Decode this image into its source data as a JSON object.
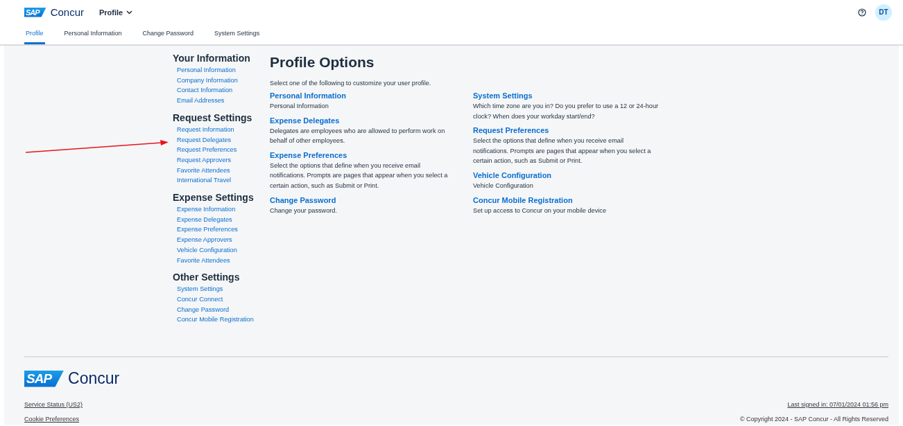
{
  "header": {
    "logo": {
      "mark": "SAP",
      "name": "Concur"
    },
    "menu": {
      "label": "Profile"
    },
    "avatar": {
      "initials": "DT"
    }
  },
  "tabs": [
    {
      "label": "Profile",
      "selected": true
    },
    {
      "label": "Personal Information",
      "selected": false
    },
    {
      "label": "Change Password",
      "selected": false
    },
    {
      "label": "System Settings",
      "selected": false
    }
  ],
  "sidebar": {
    "sections": [
      {
        "heading": "Your Information",
        "links": [
          "Personal Information",
          "Company Information",
          "Contact Information",
          "Email Addresses"
        ]
      },
      {
        "heading": "Request Settings",
        "links": [
          "Request Information",
          "Request Delegates",
          "Request Preferences",
          "Request Approvers",
          "Favorite Attendees",
          "International Travel"
        ]
      },
      {
        "heading": "Expense Settings",
        "links": [
          "Expense Information",
          "Expense Delegates",
          "Expense Preferences",
          "Expense Approvers",
          "Vehicle Configuration",
          "Favorite Attendees"
        ]
      },
      {
        "heading": "Other Settings",
        "links": [
          "System Settings",
          "Concur Connect",
          "Change Password",
          "Concur Mobile Registration"
        ]
      }
    ]
  },
  "main": {
    "title": "Profile Options",
    "intro": "Select one of the following to customize your user profile.",
    "columns": [
      [
        {
          "title": "Personal Information",
          "description": "Personal Information"
        },
        {
          "title": "Expense Delegates",
          "description": "Delegates are employees who are allowed to perform work on behalf of other employees."
        },
        {
          "title": "Expense Preferences",
          "description": "Select the options that define when you receive email notifications. Prompts are pages that appear when you select a certain action, such as Submit or Print."
        },
        {
          "title": "Change Password",
          "description": "Change your password."
        }
      ],
      [
        {
          "title": "System Settings",
          "description": "Which time zone are you in? Do you prefer to use a 12 or 24-hour clock? When does your workday start/end?"
        },
        {
          "title": "Request Preferences",
          "description": "Select the options that define when you receive email notifications. Prompts are pages that appear when you select a certain action, such as Submit or Print."
        },
        {
          "title": "Vehicle Configuration",
          "description": "Vehicle Configuration"
        },
        {
          "title": "Concur Mobile Registration",
          "description": "Set up access to Concur on your mobile device"
        }
      ]
    ]
  },
  "footer": {
    "logo": {
      "mark": "SAP",
      "name": "Concur"
    },
    "links": [
      "Service Status (US2)",
      "Cookie Preferences"
    ],
    "last_signed_in": "Last signed in: 07/01/2024 01:56 pm",
    "copyright": "© Copyright 2024 - SAP Concur - All Rights Reserved"
  }
}
